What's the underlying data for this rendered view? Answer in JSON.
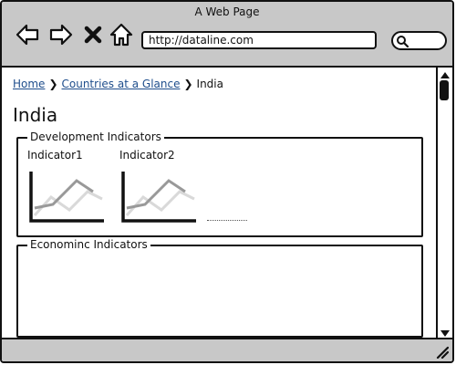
{
  "window": {
    "title": "A Web Page"
  },
  "toolbar": {
    "back_icon": "back-arrow-icon",
    "forward_icon": "forward-arrow-icon",
    "stop_icon": "close-icon",
    "home_icon": "home-icon",
    "search_icon": "search-icon",
    "address_value": "http://dataline.com"
  },
  "breadcrumb": {
    "items": [
      {
        "label": "Home",
        "link": true
      },
      {
        "label": "Countries at a Glance",
        "link": true
      },
      {
        "label": "India",
        "link": false
      }
    ]
  },
  "page": {
    "title": "India",
    "development_group": {
      "legend": "Development Indicators",
      "indicators": [
        {
          "label": "Indicator1",
          "icon": "line-chart-icon"
        },
        {
          "label": "Indicator2",
          "icon": "line-chart-icon"
        }
      ]
    },
    "economic_group": {
      "legend": "Econominc Indicators"
    }
  },
  "colors": {
    "chrome": "#c8c8c8",
    "link": "#1f4e8c",
    "chart_primary": "#999999",
    "chart_secondary": "#d9d9d9"
  }
}
